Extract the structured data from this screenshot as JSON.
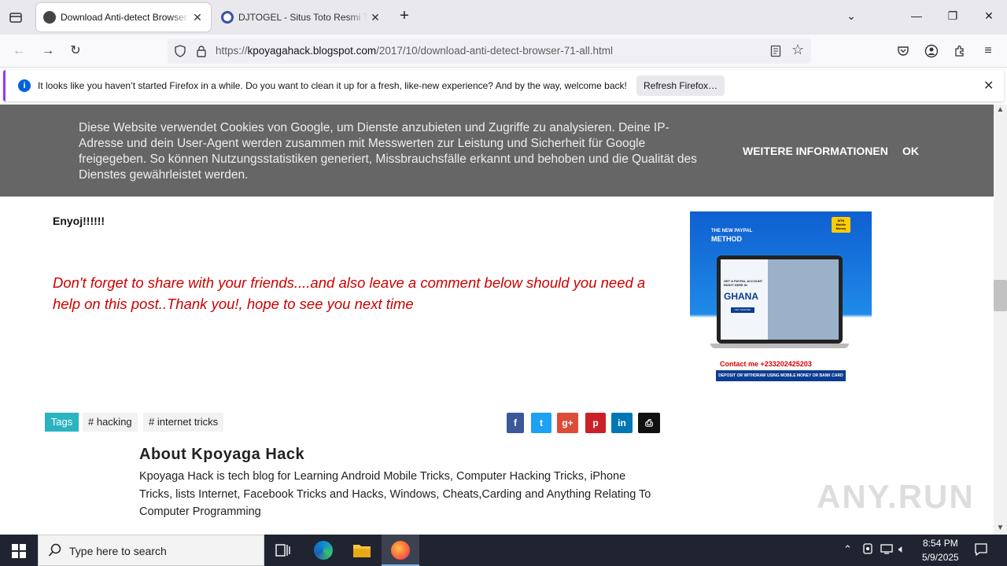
{
  "browser": {
    "tabs": [
      {
        "title": "Download Anti-detect Browser",
        "active": true
      },
      {
        "title": "DJTOGEL - Situs Toto Resmi Terg",
        "active": false
      }
    ],
    "url": {
      "scheme": "https://",
      "host": "kpoyagahack.blogspot.com",
      "path": "/2017/10/download-anti-detect-browser-71-all.html"
    },
    "notification": {
      "message": "It looks like you haven’t started Firefox in a while. Do you want to clean it up for a fresh, like-new experience? And by the way, welcome back!",
      "button": "Refresh Firefox…"
    }
  },
  "cookie_banner": {
    "text": "Diese Website verwendet Cookies von Google, um Dienste anzubieten und Zugriffe zu analysieren. Deine IP-Adresse und dein User-Agent werden zusammen mit Messwerten zur Leistung und Sicherheit für Google freigegeben. So können Nutzungsstatistiken generiert, Missbrauchsfälle erkannt und behoben und die Qualität des Dienstes gewährleistet werden.",
    "more": "WEITERE INFORMATIONEN",
    "ok": "OK"
  },
  "post": {
    "enjoy": "Enyoj!!!!!!",
    "share": "Don't forget to share with your friends....and also leave a comment below should you need a help on this post..Thank you!, hope to see you next time",
    "tags_label": "Tags",
    "tags": [
      "# hacking",
      "# internet tricks"
    ]
  },
  "ad": {
    "headline_1": "THE NEW PAYPAL",
    "headline_2": "METHOD",
    "badge": "MTN Mobile Money",
    "screen_1": "GET A PAYPAL ACCOUNT RIGHT HERE IN",
    "screen_2": "GHANA",
    "screen_btn": "GET STARTED",
    "contact": "Contact me +233202425203",
    "footer": "DEPOSIT OR WITHDRAW USING MOBILE MONEY OR BANK CARD"
  },
  "share_buttons": [
    {
      "name": "facebook",
      "glyph": "f",
      "color": "#3b5998"
    },
    {
      "name": "twitter",
      "glyph": "t",
      "color": "#1da1f2"
    },
    {
      "name": "google-plus",
      "glyph": "g+",
      "color": "#dd4b39"
    },
    {
      "name": "pinterest",
      "glyph": "p",
      "color": "#cb2027"
    },
    {
      "name": "linkedin",
      "glyph": "in",
      "color": "#0077b5"
    },
    {
      "name": "print",
      "glyph": "⎙",
      "color": "#111111"
    }
  ],
  "about": {
    "title": "About Kpoyaga Hack",
    "text": "Kpoyaga Hack is tech blog for Learning Android Mobile Tricks, Computer Hacking Tricks, iPhone Tricks, lists Internet, Facebook Tricks and Hacks, Windows, Cheats,Carding and Anything Relating To Computer Programming"
  },
  "watermark": "ANY.RUN",
  "taskbar": {
    "search_placeholder": "Type here to search",
    "time": "8:54 PM",
    "date": "5/9/2025"
  }
}
